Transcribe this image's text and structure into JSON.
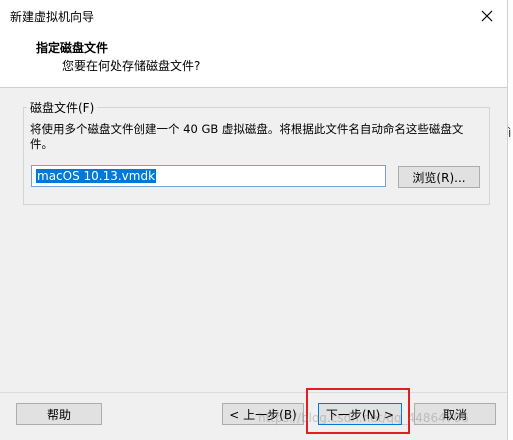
{
  "window": {
    "title": "新建虚拟机向导"
  },
  "header": {
    "title": "指定磁盘文件",
    "subtitle": "您要在何处存储磁盘文件?"
  },
  "disk_group": {
    "label": "磁盘文件(F)",
    "description": "将使用多个磁盘文件创建一个 40 GB 虚拟磁盘。将根据此文件名自动命名这些磁盘文件。",
    "file_value": "macOS 10.13.vmdk",
    "browse_label": "浏览(R)..."
  },
  "footer": {
    "help_label": "帮助",
    "back_label": "< 上一步(B)",
    "next_label": "下一步(N) >",
    "cancel_label": "取消"
  },
  "background": {
    "edge_char": "ì",
    "watermark": "https://blog.csdn.net/qq_44864706"
  },
  "colors": {
    "highlight": "#e02020",
    "selection": "#0078d7"
  }
}
